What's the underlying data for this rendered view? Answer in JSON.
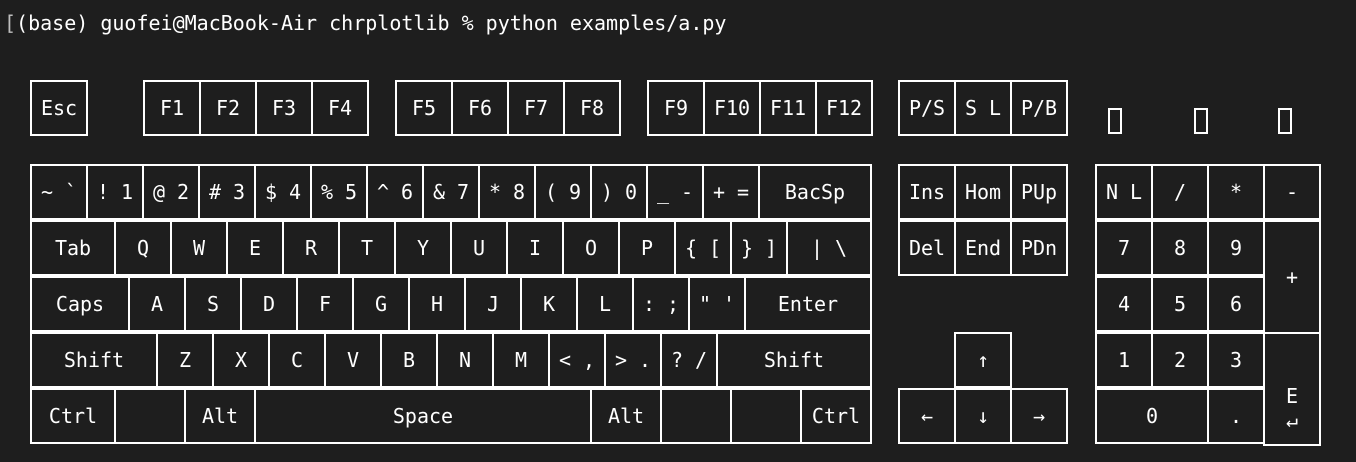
{
  "terminal": {
    "bracket": "[",
    "prompt": "(base) guofei@MacBook-Air chrplotlib % python examples/a.py"
  },
  "keyboard": {
    "function_row": [
      "Esc",
      "F1",
      "F2",
      "F3",
      "F4",
      "F5",
      "F6",
      "F7",
      "F8",
      "F9",
      "F10",
      "F11",
      "F12",
      "P/S",
      "S L",
      "P/B"
    ],
    "indicator_lights": [
      "num-lock-light",
      "caps-lock-light",
      "scroll-lock-light"
    ],
    "number_row": [
      "~ `",
      "! 1",
      "@ 2",
      "# 3",
      "$ 4",
      "% 5",
      "^ 6",
      "& 7",
      "* 8",
      "( 9",
      ") 0",
      "_ -",
      "+ =",
      "BacSp"
    ],
    "tab_row": [
      "Tab",
      "Q",
      "W",
      "E",
      "R",
      "T",
      "Y",
      "U",
      "I",
      "O",
      "P",
      "{ [",
      "} ]",
      "| \\"
    ],
    "caps_row": [
      "Caps",
      "A",
      "S",
      "D",
      "F",
      "G",
      "H",
      "J",
      "K",
      "L",
      ": ;",
      "\" '",
      "Enter"
    ],
    "shift_row": [
      "Shift",
      "Z",
      "X",
      "C",
      "V",
      "B",
      "N",
      "M",
      "< ,",
      "> .",
      "? /",
      "Shift"
    ],
    "bottom_row": [
      "Ctrl",
      "",
      "Alt",
      "Space",
      "Alt",
      "",
      "",
      "Ctrl"
    ],
    "nav_top": [
      "Ins",
      "Hom",
      "PUp"
    ],
    "nav_bottom": [
      "Del",
      "End",
      "PDn"
    ],
    "arrows": {
      "up": "↑",
      "left": "←",
      "down": "↓",
      "right": "→"
    },
    "numpad": {
      "row1": [
        "N L",
        "/",
        "*",
        "-"
      ],
      "row2": [
        "7",
        "8",
        "9"
      ],
      "row3": [
        "4",
        "5",
        "6"
      ],
      "row4": [
        "1",
        "2",
        "3"
      ],
      "zero": "0",
      "dot": ".",
      "plus": "+",
      "enter_top": "E",
      "enter_bottom": "↵"
    }
  }
}
